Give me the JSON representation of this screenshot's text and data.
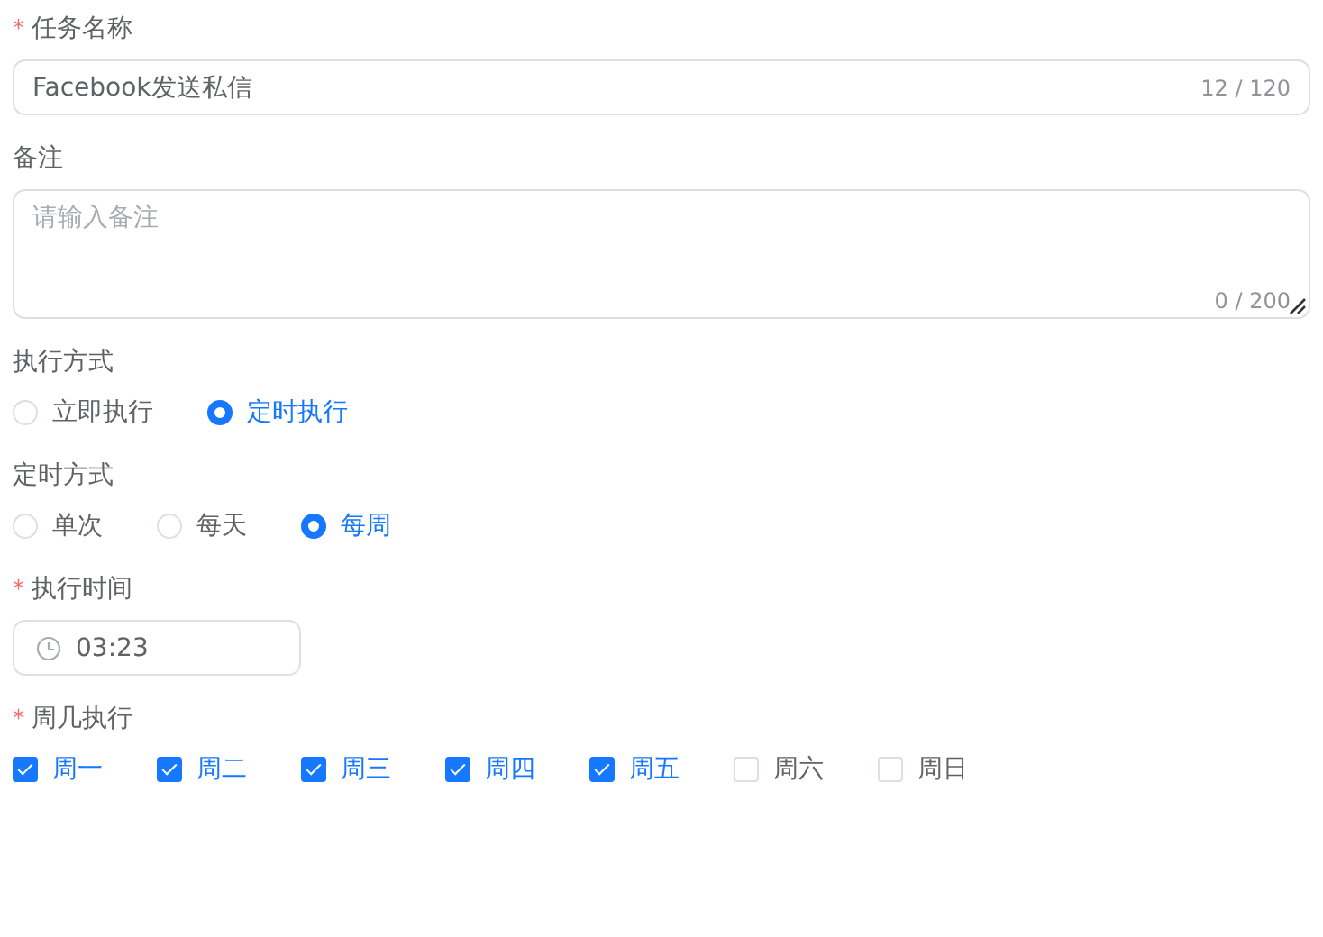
{
  "fields": [
    {
      "kind": "text",
      "label": "任务名称",
      "required_mark": "*",
      "value": "Facebook发送私信",
      "counter": "12 / 120"
    },
    {
      "kind": "textarea",
      "label": "备注",
      "placeholder": "请输入备注",
      "counter": "0 / 200"
    },
    {
      "kind": "radio",
      "label": "执行方式",
      "options": [
        {
          "label": "立即执行",
          "selected": false
        },
        {
          "label": "定时执行",
          "selected": true
        }
      ]
    },
    {
      "kind": "radio",
      "label": "定时方式",
      "options": [
        {
          "label": "单次",
          "selected": false
        },
        {
          "label": "每天",
          "selected": false
        },
        {
          "label": "每周",
          "selected": true
        }
      ]
    },
    {
      "kind": "time",
      "label": "执行时间",
      "required_mark": "*",
      "value": "03:23"
    },
    {
      "kind": "checkbox",
      "label": "周几执行",
      "required_mark": "*",
      "options": [
        {
          "label": "周一",
          "checked": true
        },
        {
          "label": "周二",
          "checked": true
        },
        {
          "label": "周三",
          "checked": true
        },
        {
          "label": "周四",
          "checked": true
        },
        {
          "label": "周五",
          "checked": true
        },
        {
          "label": "周六",
          "checked": false
        },
        {
          "label": "周日",
          "checked": false
        }
      ]
    }
  ]
}
